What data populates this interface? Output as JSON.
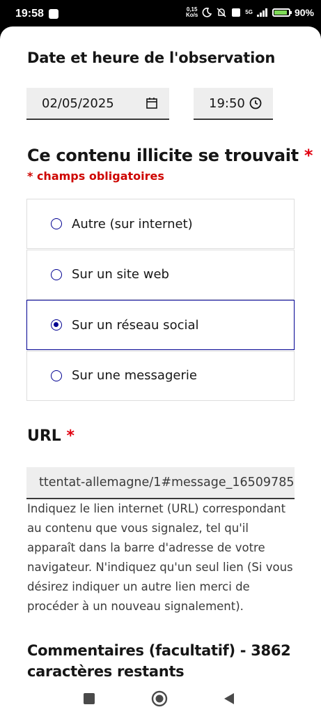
{
  "status_bar": {
    "time": "19:58",
    "net_speed_top": "0,15",
    "net_speed_bottom": "Ko/s",
    "network": "5G",
    "battery_percent": "90%",
    "battery_level": 0.9,
    "icons": [
      "notification-icon",
      "moon-icon",
      "alarm-off-icon",
      "volte-icon",
      "signal-icon",
      "battery-icon"
    ]
  },
  "observation": {
    "heading": "Date et heure de l'observation",
    "date_value": "02/05/2025",
    "time_value": "19:50"
  },
  "location": {
    "heading": "Ce contenu illicite se trouvait",
    "required_star": "*",
    "required_note": "* champs obligatoires",
    "options": [
      {
        "label": "Autre (sur internet)",
        "selected": false
      },
      {
        "label": "Sur un site web",
        "selected": false
      },
      {
        "label": "Sur un réseau social",
        "selected": true
      },
      {
        "label": "Sur une messagerie",
        "selected": false
      }
    ]
  },
  "url": {
    "heading": "URL",
    "required_star": "*",
    "value": "ttentat-allemagne/1#message_16509785",
    "hint": "Indiquez le lien internet (URL) correspondant au contenu que vous signalez, tel qu'il apparaît dans la barre d'adresse de votre navigateur. N'indiquez qu'un seul lien (Si vous désirez indiquer un autre lien merci de procéder à un nouveau signalement)."
  },
  "comments": {
    "heading": "Commentaires (facultatif) - 3862 caractères restants"
  },
  "colors": {
    "primary": "#000091",
    "required": "#ce0500",
    "field_bg": "#eeeeee"
  }
}
